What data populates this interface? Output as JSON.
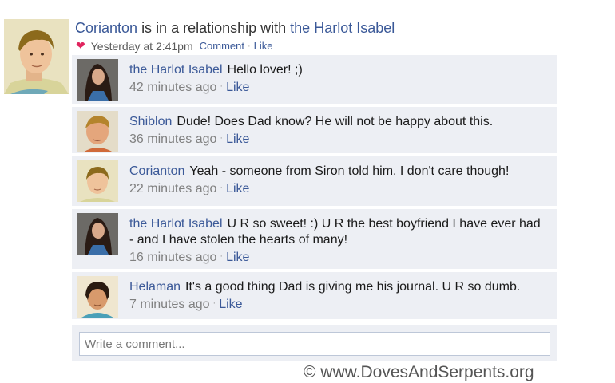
{
  "post": {
    "author": "Corianton",
    "status_middle": "is in a relationship with",
    "partner": "the Harlot Isabel",
    "timestamp": "Yesterday at 2:41pm",
    "comment_label": "Comment",
    "like_label": "Like",
    "heart_icon": "heart-icon",
    "link_color": "#3b5998"
  },
  "comments": [
    {
      "author": "the Harlot Isabel",
      "text": "Hello lover!  ;)",
      "time": "42 minutes ago",
      "like": "Like"
    },
    {
      "author": "Shiblon",
      "text": "Dude!  Does Dad know?  He will not be happy about this.",
      "time": "36 minutes ago",
      "like": "Like"
    },
    {
      "author": "Corianton",
      "text": "Yeah - someone from Siron told him.  I don't care though!",
      "time": "22 minutes ago",
      "like": "Like"
    },
    {
      "author": "the Harlot Isabel",
      "text": "U R so sweet!  :)  U R the best boyfriend I have ever had - and I have stolen the hearts of many!",
      "time": "16 minutes ago",
      "like": "Like"
    },
    {
      "author": "Helaman",
      "text": "It's a good thing Dad is giving me his journal.  U R so dumb.",
      "time": "7 minutes ago",
      "like": "Like"
    }
  ],
  "write_comment": {
    "placeholder": "Write a comment..."
  },
  "watermark": "© www.DovesAndSerpents.org"
}
